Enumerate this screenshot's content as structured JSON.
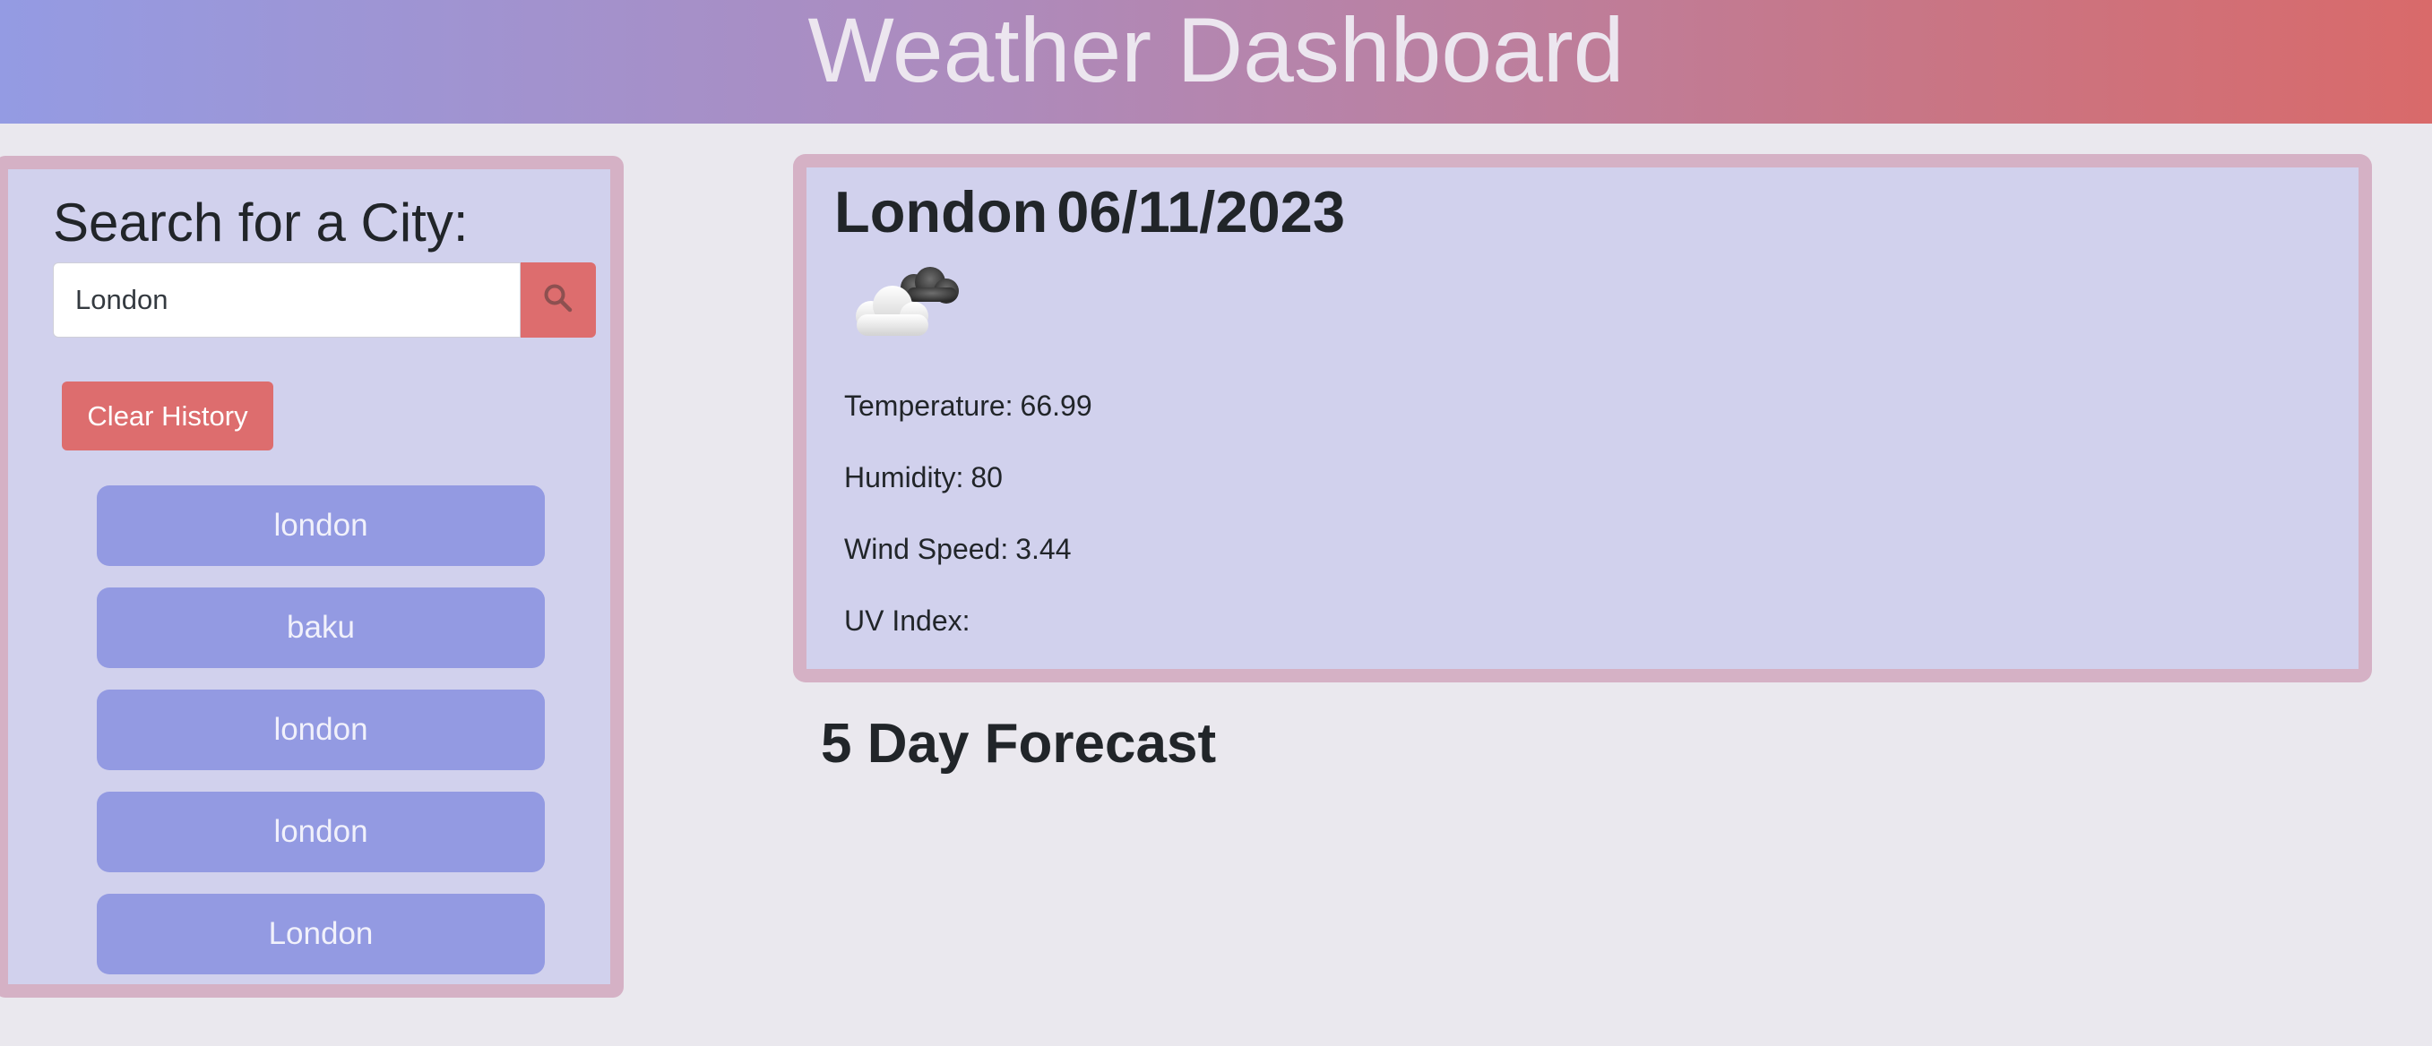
{
  "header": {
    "title": "Weather Dashboard"
  },
  "search": {
    "heading": "Search for a City:",
    "input_value": "London",
    "search_icon": "search-icon",
    "clear_label": "Clear History",
    "history": [
      "london",
      "baku",
      "london",
      "london",
      "London"
    ]
  },
  "current": {
    "city": "London",
    "date": "06/11/2023",
    "icon": "partly-cloudy-night-icon",
    "temperature_label": "Temperature:",
    "temperature_value": "66.99",
    "humidity_label": "Humidity:",
    "humidity_value": "80",
    "wind_label": "Wind Speed:",
    "wind_value": "3.44",
    "uv_label": "UV Index:",
    "uv_value": ""
  },
  "forecast": {
    "heading": "5 Day Forecast"
  },
  "colors": {
    "accent_red": "#dd6d6e",
    "panel_bg": "#d1d1ed",
    "panel_border": "#d5b1c5",
    "history_button": "#939ae2",
    "page_bg": "#eae8ee"
  }
}
